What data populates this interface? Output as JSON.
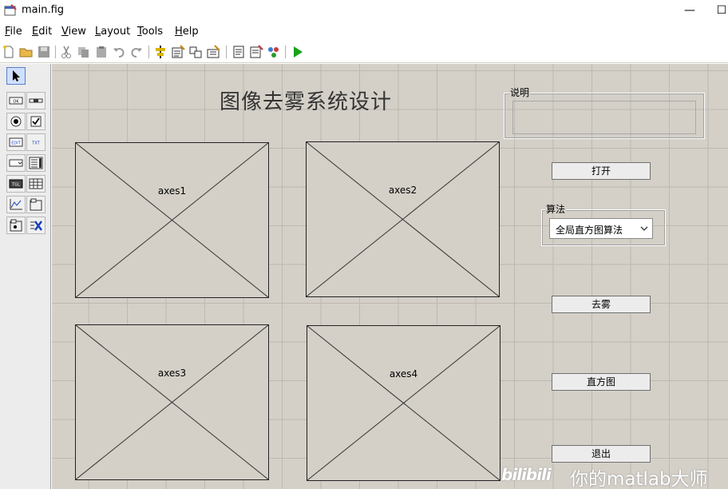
{
  "window": {
    "title": "main.fig",
    "min_glyph": "—",
    "max_glyph": "☐"
  },
  "menu": [
    {
      "accel": "F",
      "rest": "ile"
    },
    {
      "accel": "E",
      "rest": "dit"
    },
    {
      "accel": "V",
      "rest": "iew"
    },
    {
      "accel": "L",
      "rest": "ayout"
    },
    {
      "accel": "T",
      "rest": "ools"
    },
    {
      "accel": "H",
      "rest": "elp"
    }
  ],
  "toolbar_icons": [
    "new-file-icon",
    "open-folder-icon",
    "save-icon",
    "cut-icon",
    "copy-icon",
    "paste-icon",
    "undo-icon",
    "redo-icon",
    "align-objects-icon",
    "menu-editor-icon",
    "tab-order-editor-icon",
    "toolbar-editor-icon",
    "mfile-editor-icon",
    "property-inspector-icon",
    "object-browser-icon",
    "run-figure-icon"
  ],
  "palette": {
    "items": [
      "select-tool",
      "push-button",
      "slider",
      "radio-button",
      "checkbox",
      "edit-text",
      "static-text",
      "popup-menu",
      "listbox",
      "toggle-button",
      "table",
      "axes",
      "panel",
      "button-group",
      "activex-control"
    ],
    "labels": {
      "push": "OK",
      "edit": "EDIT",
      "text": "TXT",
      "toggle": "TGL"
    }
  },
  "canvas": {
    "heading": "图像去雾系统设计",
    "axes": [
      "axes1",
      "axes2",
      "axes3",
      "axes4"
    ],
    "desc_panel": {
      "title": "说明"
    },
    "algo_panel": {
      "title": "算法",
      "selected": "全局直方图算法"
    },
    "buttons": {
      "open": "打开",
      "dehaze": "去雾",
      "histogram": "直方图",
      "exit": "退出"
    }
  },
  "watermark": {
    "logo": "bilibili",
    "text": "你的matlab大师"
  },
  "colors": {
    "canvas_bg": "#d4d0c8",
    "grid": "#bdb9b1",
    "run_green": "#1aa31a"
  }
}
